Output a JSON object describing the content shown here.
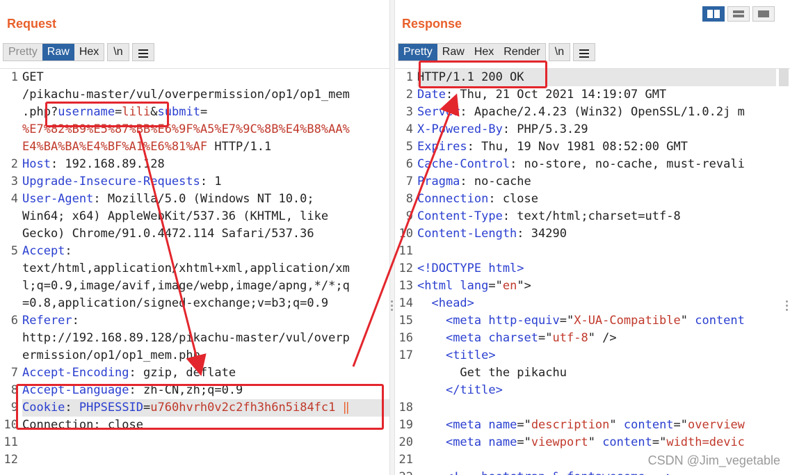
{
  "request": {
    "title": "Request",
    "tabs": [
      "Pretty",
      "Raw",
      "Hex"
    ],
    "active_tab": "Raw",
    "newline_button": "\\n",
    "lines": [
      {
        "n": "1",
        "parts": [
          [
            "",
            "GET"
          ]
        ]
      },
      {
        "n": "",
        "parts": [
          [
            "",
            "/pikachu-master/vul/overpermission/op1/op1_mem"
          ]
        ]
      },
      {
        "n": "",
        "parts": [
          [
            "",
            ".php?"
          ],
          [
            "k",
            "username"
          ],
          [
            "",
            "="
          ],
          [
            "v",
            "lili"
          ],
          [
            "",
            "&"
          ],
          [
            "k",
            "submit"
          ],
          [
            "",
            "="
          ]
        ]
      },
      {
        "n": "",
        "parts": [
          [
            "v",
            "%E7%82%B9%E5%87%BB%E6%9F%A5%E7%9C%8B%E4%B8%AA%"
          ]
        ]
      },
      {
        "n": "",
        "parts": [
          [
            "v",
            "E4%BA%BA%E4%BF%A1%E6%81%AF"
          ],
          [
            "",
            " HTTP/1.1"
          ]
        ]
      },
      {
        "n": "2",
        "parts": [
          [
            "k",
            "Host"
          ],
          [
            "",
            ": 192.168.89.128"
          ]
        ]
      },
      {
        "n": "3",
        "parts": [
          [
            "k",
            "Upgrade-Insecure-Requests"
          ],
          [
            "",
            ": 1"
          ]
        ]
      },
      {
        "n": "4",
        "parts": [
          [
            "k",
            "User-Agent"
          ],
          [
            "",
            ": Mozilla/5.0 (Windows NT 10.0;"
          ]
        ]
      },
      {
        "n": "",
        "parts": [
          [
            "",
            "Win64; x64) AppleWebKit/537.36 (KHTML, like"
          ]
        ]
      },
      {
        "n": "",
        "parts": [
          [
            "",
            "Gecko) Chrome/91.0.4472.114 Safari/537.36"
          ]
        ]
      },
      {
        "n": "5",
        "parts": [
          [
            "k",
            "Accept"
          ],
          [
            "",
            ":"
          ]
        ]
      },
      {
        "n": "",
        "parts": [
          [
            "",
            "text/html,application/xhtml+xml,application/xm"
          ]
        ]
      },
      {
        "n": "",
        "parts": [
          [
            "",
            "l;q=0.9,image/avif,image/webp,image/apng,*/*;q"
          ]
        ]
      },
      {
        "n": "",
        "parts": [
          [
            "",
            "=0.8,application/signed-exchange;v=b3;q=0.9"
          ]
        ]
      },
      {
        "n": "6",
        "parts": [
          [
            "k",
            "Referer"
          ],
          [
            "",
            ":"
          ]
        ]
      },
      {
        "n": "",
        "parts": [
          [
            "",
            "http://192.168.89.128/pikachu-master/vul/overp"
          ]
        ]
      },
      {
        "n": "",
        "parts": [
          [
            "",
            "ermission/op1/op1_mem.php"
          ]
        ]
      },
      {
        "n": "7",
        "parts": [
          [
            "k",
            "Accept-Encoding"
          ],
          [
            "",
            ": gzip, deflate"
          ]
        ]
      },
      {
        "n": "8",
        "parts": [
          [
            "k",
            "Accept-Language"
          ],
          [
            "",
            ": zh-CN,zh;q=0.9"
          ]
        ]
      },
      {
        "n": "9",
        "parts": [
          [
            "k",
            "Cookie"
          ],
          [
            "",
            ": "
          ],
          [
            "k",
            "PHPSESSID"
          ],
          [
            "",
            "="
          ],
          [
            "v",
            "u760hvrh0v2c2fh3h6n5i84fc1"
          ]
        ],
        "highlight": true
      },
      {
        "n": "10",
        "parts": [
          [
            "",
            "Connection: close"
          ]
        ]
      },
      {
        "n": "11",
        "parts": []
      },
      {
        "n": "12",
        "parts": []
      }
    ]
  },
  "response": {
    "title": "Response",
    "tabs": [
      "Pretty",
      "Raw",
      "Hex",
      "Render"
    ],
    "active_tab": "Pretty",
    "newline_button": "\\n",
    "lines": [
      {
        "n": "1",
        "parts": [
          [
            "",
            "HTTP/1.1 200 OK"
          ]
        ],
        "highlight": true
      },
      {
        "n": "2",
        "parts": [
          [
            "k",
            "Date"
          ],
          [
            "",
            ": Thu, 21 Oct 2021 14:19:07 GMT"
          ]
        ]
      },
      {
        "n": "3",
        "parts": [
          [
            "k",
            "Server"
          ],
          [
            "",
            ": Apache/2.4.23 (Win32) OpenSSL/1.0.2j m"
          ]
        ]
      },
      {
        "n": "4",
        "parts": [
          [
            "k",
            "X-Powered-By"
          ],
          [
            "",
            ": PHP/5.3.29"
          ]
        ]
      },
      {
        "n": "5",
        "parts": [
          [
            "k",
            "Expires"
          ],
          [
            "",
            ": Thu, 19 Nov 1981 08:52:00 GMT"
          ]
        ]
      },
      {
        "n": "6",
        "parts": [
          [
            "k",
            "Cache-Control"
          ],
          [
            "",
            ": no-store, no-cache, must-revali"
          ]
        ]
      },
      {
        "n": "7",
        "parts": [
          [
            "k",
            "Pragma"
          ],
          [
            "",
            ": no-cache"
          ]
        ]
      },
      {
        "n": "8",
        "parts": [
          [
            "k",
            "Connection"
          ],
          [
            "",
            ": close"
          ]
        ]
      },
      {
        "n": "9",
        "parts": [
          [
            "k",
            "Content-Type"
          ],
          [
            "",
            ": text/html;charset=utf-8"
          ]
        ]
      },
      {
        "n": "10",
        "parts": [
          [
            "k",
            "Content-Length"
          ],
          [
            "",
            ": 34290"
          ]
        ]
      },
      {
        "n": "11",
        "parts": []
      },
      {
        "n": "12",
        "parts": [
          [
            "t",
            "<!DOCTYPE html>"
          ]
        ]
      },
      {
        "n": "13",
        "parts": [
          [
            "t",
            "<html "
          ],
          [
            "a",
            "lang"
          ],
          [
            "",
            "=\""
          ],
          [
            "s",
            "en"
          ],
          [
            "",
            "\">"
          ]
        ]
      },
      {
        "n": "14",
        "parts": [
          [
            "",
            "  "
          ],
          [
            "t",
            "<head>"
          ]
        ]
      },
      {
        "n": "15",
        "parts": [
          [
            "",
            "    "
          ],
          [
            "t",
            "<meta "
          ],
          [
            "a",
            "http-equiv"
          ],
          [
            "",
            "=\""
          ],
          [
            "s",
            "X-UA-Compatible"
          ],
          [
            "",
            "\" "
          ],
          [
            "a",
            "content"
          ]
        ]
      },
      {
        "n": "16",
        "parts": [
          [
            "",
            "    "
          ],
          [
            "t",
            "<meta "
          ],
          [
            "a",
            "charset"
          ],
          [
            "",
            "=\""
          ],
          [
            "s",
            "utf-8"
          ],
          [
            "",
            "\" />"
          ]
        ]
      },
      {
        "n": "17",
        "parts": [
          [
            "",
            "    "
          ],
          [
            "t",
            "<title>"
          ]
        ]
      },
      {
        "n": "",
        "parts": [
          [
            "",
            "      Get the pikachu"
          ]
        ]
      },
      {
        "n": "",
        "parts": [
          [
            "",
            "    "
          ],
          [
            "t",
            "</title>"
          ]
        ]
      },
      {
        "n": "18",
        "parts": []
      },
      {
        "n": "19",
        "parts": [
          [
            "",
            "    "
          ],
          [
            "t",
            "<meta "
          ],
          [
            "a",
            "name"
          ],
          [
            "",
            "=\""
          ],
          [
            "s",
            "description"
          ],
          [
            "",
            "\" "
          ],
          [
            "a",
            "content"
          ],
          [
            "",
            "=\""
          ],
          [
            "s",
            "overview"
          ]
        ]
      },
      {
        "n": "20",
        "parts": [
          [
            "",
            "    "
          ],
          [
            "t",
            "<meta "
          ],
          [
            "a",
            "name"
          ],
          [
            "",
            "=\""
          ],
          [
            "s",
            "viewport"
          ],
          [
            "",
            "\" "
          ],
          [
            "a",
            "content"
          ],
          [
            "",
            "=\""
          ],
          [
            "s",
            "width=devic"
          ]
        ]
      },
      {
        "n": "21",
        "parts": []
      },
      {
        "n": "22",
        "parts": [
          [
            "",
            "    "
          ],
          [
            "t",
            "<!-- bootstrap & fontawesome -->"
          ]
        ]
      }
    ]
  },
  "icons": {
    "menu": "hamburger-menu-icon",
    "layout_side_by_side": "layout-columns-icon",
    "layout_stacked": "layout-rows-icon",
    "layout_single": "layout-single-icon"
  },
  "watermark": "CSDN @Jim_vegetable",
  "annotation_color": "#e3262d"
}
